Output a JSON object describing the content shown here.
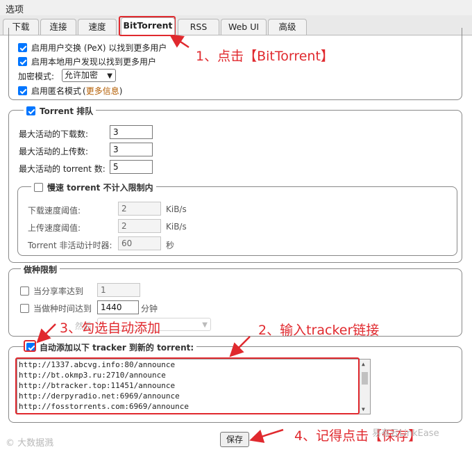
{
  "window": {
    "title": "选项"
  },
  "tabs": [
    {
      "label": "下载"
    },
    {
      "label": "连接"
    },
    {
      "label": "速度"
    },
    {
      "label": "BitTorrent"
    },
    {
      "label": "RSS"
    },
    {
      "label": "Web UI"
    },
    {
      "label": "高级"
    }
  ],
  "privacy": {
    "pex_label": "启用用户交换 (PeX) 以找到更多用户",
    "lsd_label": "启用本地用户发现以找到更多用户",
    "encryption_label": "加密模式:",
    "encryption_value": "允许加密",
    "anon_label": "启用匿名模式",
    "anon_more_open": "(",
    "anon_more": "更多信息",
    "anon_more_close": ")"
  },
  "queue": {
    "title": "Torrent 排队",
    "max_downloads_label": "最大活动的下载数:",
    "max_downloads": "3",
    "max_uploads_label": "最大活动的上传数:",
    "max_uploads": "3",
    "max_torrents_label": "最大活动的 torrent 数:",
    "max_torrents": "5",
    "slow": {
      "title": "慢速 torrent 不计入限制内",
      "dl_label": "下载速度阈值:",
      "dl_value": "2",
      "dl_unit": "KiB/s",
      "ul_label": "上传速度阈值:",
      "ul_value": "2",
      "ul_unit": "KiB/s",
      "timer_label": "Torrent 非活动计时器:",
      "timer_value": "60",
      "timer_unit": "秒"
    }
  },
  "seeding": {
    "title": "做种限制",
    "ratio_label": "当分享率达到",
    "ratio_value": "1",
    "time_label": "当做种时间达到",
    "time_value": "1440",
    "time_unit": "分钟",
    "action_label": "然后",
    "action_value": ""
  },
  "trackers": {
    "title": "自动添加以下 tracker 到新的 torrent:",
    "list": [
      "http://1337.abcvg.info:80/announce",
      "http://bt.okmp3.ru:2710/announce",
      "http://btracker.top:11451/announce",
      "http://derpyradio.net:6969/announce",
      "http://fosstorrents.com:6969/announce"
    ]
  },
  "save_label": "保存",
  "annotations": {
    "a1": "1、点击【BitTorrent】",
    "a2": "2、输入tracker链接",
    "a3": "3、勾选自动添加",
    "a4": "4、记得点击【保存】"
  },
  "watermarks": {
    "left": "© 大数据溅",
    "right": "易有云LinkEase"
  },
  "colors": {
    "annotation_red": "#e0292e",
    "checkbox_blue": "#0075ff",
    "link_orange": "#b35c00"
  }
}
